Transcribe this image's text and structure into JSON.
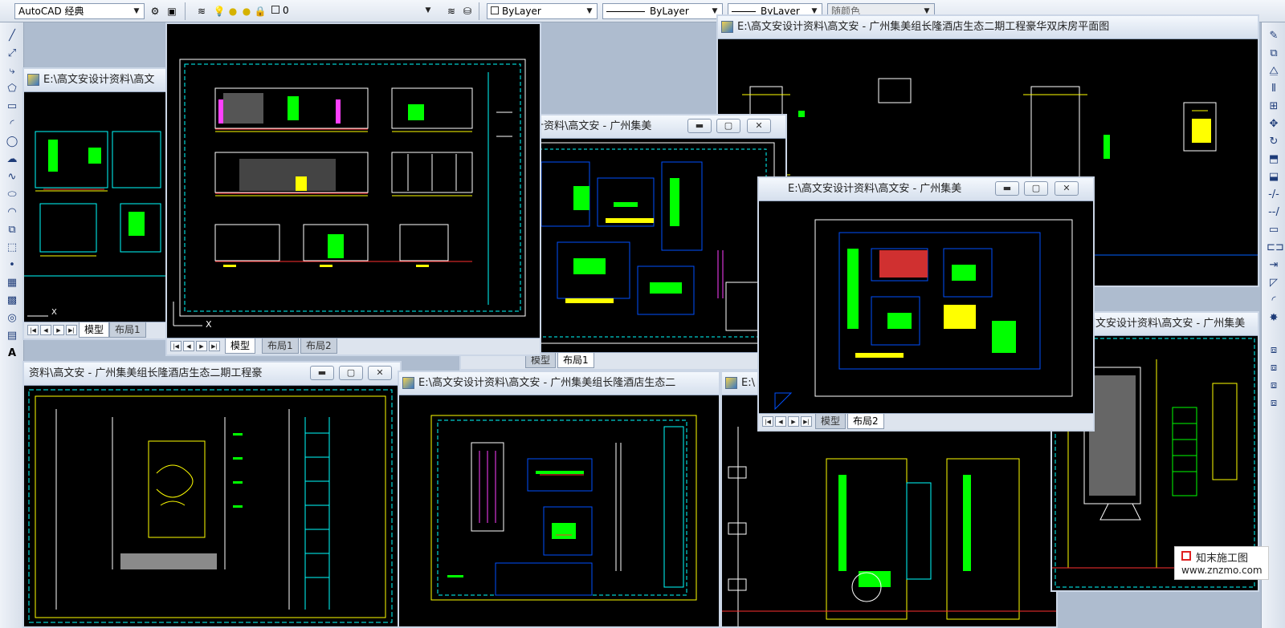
{
  "toolbar": {
    "workspace": "AutoCAD 经典",
    "layer": "0",
    "color": "ByLayer",
    "linetype": "ByLayer",
    "lineweight": "ByLayer",
    "plotstyle": "随颜色"
  },
  "windows": [
    {
      "title": "E:\\高文安设计资料\\高文",
      "tabs": [
        "模型",
        "布局1"
      ],
      "active_tab": 0
    },
    {
      "title": "",
      "tabs": [
        "模型",
        "布局1",
        "布局2"
      ],
      "active_tab": 0
    },
    {
      "title": "E:\\高文安设计资料\\高文安 - 广州集美组长隆酒店生态二期工程豪华双床房平面图",
      "tabs": [],
      "active_tab": -1
    },
    {
      "title": "计资料\\高文安 - 广州集美",
      "tabs": [
        "模型",
        "布局1"
      ],
      "active_tab": 1
    },
    {
      "title": "E:\\高文安设计资料\\高文安 - 广州集美",
      "tabs": [
        "模型",
        "布局2"
      ],
      "active_tab": 1
    },
    {
      "title": "E:\\高文安设计资料\\高文安 - 广州集美",
      "tabs": [],
      "active_tab": -1
    },
    {
      "title": "资料\\高文安 - 广州集美组长隆酒店生态二期工程豪",
      "tabs": [],
      "active_tab": -1
    },
    {
      "title": "E:\\高文安设计资料\\高文安 - 广州集美组长隆酒店生态二",
      "tabs": [],
      "active_tab": -1
    },
    {
      "title": "E:\\",
      "tabs": [],
      "active_tab": -1
    }
  ],
  "ucs_label": "X",
  "watermark": {
    "brand": "知末施工图",
    "url": "www.znzmo.com"
  },
  "colors": {
    "cad_background": "#000000",
    "accent": "#ffff00"
  }
}
